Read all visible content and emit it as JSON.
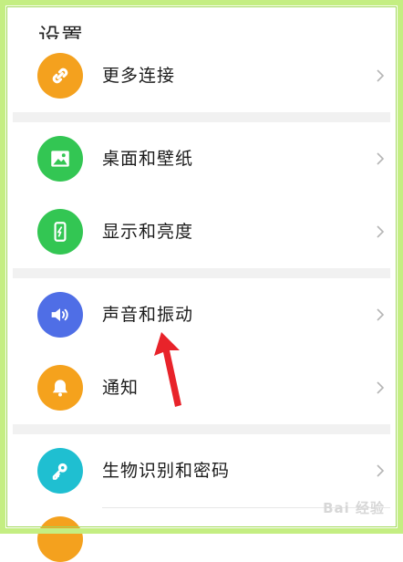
{
  "header": {
    "title": "设置"
  },
  "rows": [
    {
      "label": "更多连接",
      "icon": "link-icon",
      "color": "#f4a11e"
    },
    {
      "label": "桌面和壁纸",
      "icon": "image-icon",
      "color": "#33c653"
    },
    {
      "label": "显示和亮度",
      "icon": "phone-brightness-icon",
      "color": "#33c653"
    },
    {
      "label": "声音和振动",
      "icon": "speaker-icon",
      "color": "#4f6ee6"
    },
    {
      "label": "通知",
      "icon": "bell-icon",
      "color": "#f5a21d"
    },
    {
      "label": "生物识别和密码",
      "icon": "key-icon",
      "color": "#1fbfd1"
    }
  ],
  "annotation": {
    "color": "#e8232a"
  },
  "watermark": "Bai 经验"
}
